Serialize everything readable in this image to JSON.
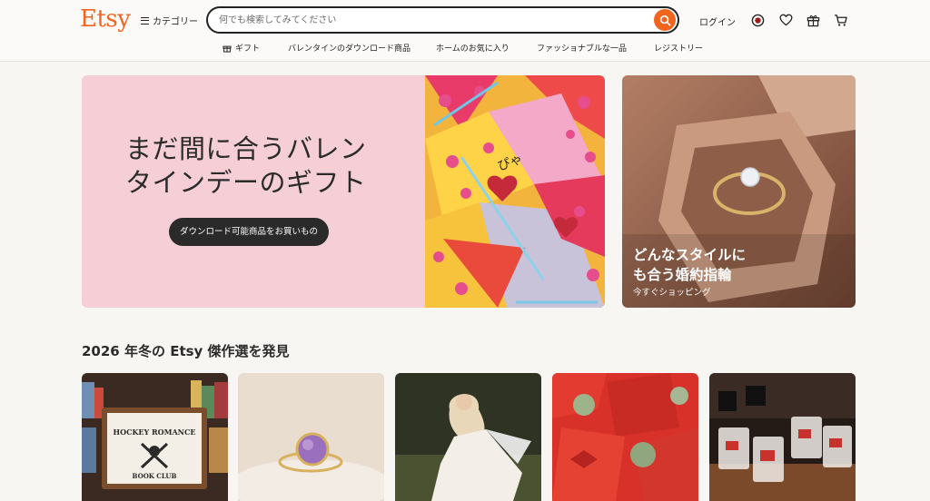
{
  "header": {
    "logo": "Etsy",
    "categories_label": "カテゴリー",
    "search_placeholder": "何でも検索してみてください",
    "login_label": "ログイン"
  },
  "nav": [
    {
      "label": "ギフト",
      "icon": "gift-icon"
    },
    {
      "label": "バレンタインのダウンロード商品"
    },
    {
      "label": "ホームのお気に入り"
    },
    {
      "label": "ファッショナブルな一品"
    },
    {
      "label": "レジストリー"
    }
  ],
  "hero": {
    "title_line1": "まだ間に合うバレン",
    "title_line2": "タインデーのギフト",
    "button": "ダウンロード可能商品をお買いもの",
    "bg_color": "#f5cfd5"
  },
  "promo": {
    "title_line1": "どんなスタイルに",
    "title_line2": "も合う婚約指輪",
    "subtitle": "今すぐショッピング"
  },
  "picks": {
    "title": "2026 年冬の Etsy 傑作選を発見",
    "cards": [
      {
        "name": "hockey-romance-sign",
        "sign_line1": "HOCKEY ROMANCE",
        "sign_line2": "BOOK CLUB"
      },
      {
        "name": "amethyst-ring"
      },
      {
        "name": "white-dress"
      },
      {
        "name": "red-cards"
      },
      {
        "name": "hockey-glasses"
      }
    ]
  },
  "colors": {
    "accent": "#f1641e",
    "text": "#222222",
    "page_bg": "#f8f6f3"
  }
}
